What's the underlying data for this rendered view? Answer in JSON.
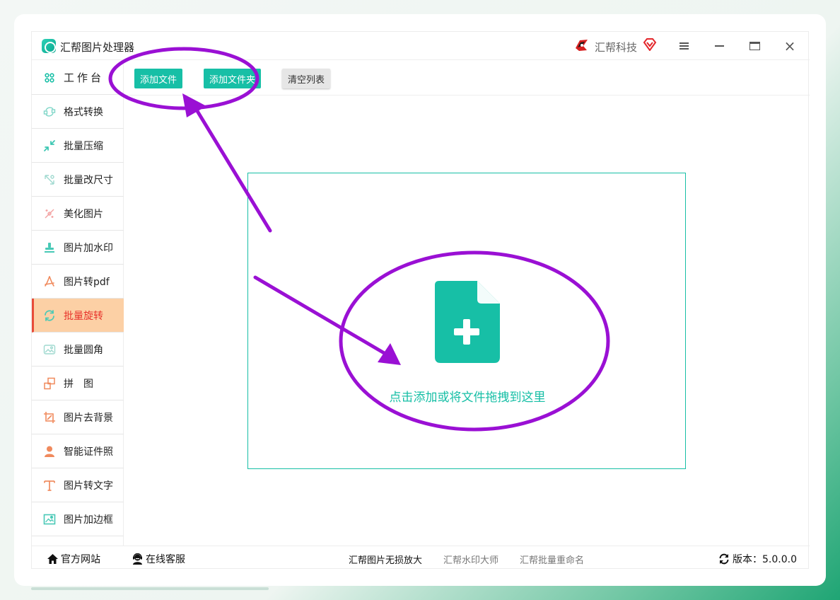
{
  "window": {
    "app_title": "汇帮图片处理器",
    "brand_name": "汇帮科技",
    "icons": {
      "logo": "app-logo-icon",
      "brand": "huibang-logo-icon",
      "vip": "diamond-vip-icon",
      "menu": "menu-icon",
      "minimize": "minimize-icon",
      "maximize": "maximize-icon",
      "close": "close-icon"
    },
    "close_glyph": "×"
  },
  "sidebar": {
    "items": [
      {
        "label": "工作台",
        "icon": "grid-icon",
        "active": false
      },
      {
        "label": "格式转换",
        "icon": "convert-icon",
        "active": false
      },
      {
        "label": "批量压缩",
        "icon": "compress-icon",
        "active": false
      },
      {
        "label": "批量改尺寸",
        "icon": "resize-icon",
        "active": false
      },
      {
        "label": "美化图片",
        "icon": "beautify-icon",
        "active": false
      },
      {
        "label": "图片加水印",
        "icon": "stamp-icon",
        "active": false
      },
      {
        "label": "图片转pdf",
        "icon": "pdf-icon",
        "active": false
      },
      {
        "label": "批量旋转",
        "icon": "rotate-icon",
        "active": true
      },
      {
        "label": "批量圆角",
        "icon": "rounded-corner-icon",
        "active": false
      },
      {
        "label": "拼　图",
        "icon": "puzzle-icon",
        "active": false
      },
      {
        "label": "图片去背景",
        "icon": "crop-icon",
        "active": false
      },
      {
        "label": "智能证件照",
        "icon": "person-icon",
        "active": false
      },
      {
        "label": "图片转文字",
        "icon": "text-icon",
        "active": false
      },
      {
        "label": "图片加边框",
        "icon": "frame-icon",
        "active": false
      }
    ]
  },
  "toolbar": {
    "add_file": "添加文件",
    "add_folder": "添加文件夹",
    "clear_list": "清空列表"
  },
  "dropzone": {
    "hint": "点击添加或将文件拖拽到这里",
    "icon": "file-add-icon"
  },
  "footer": {
    "website": "官方网站",
    "support": "在线客服",
    "lossless": "汇帮图片无损放大",
    "watermark": "汇帮水印大师",
    "rename": "汇帮批量重命名",
    "version": "版本：5.0.0.0"
  },
  "colors": {
    "accent": "#17bfa6",
    "active_bg": "#fcd0a5",
    "active_text": "#e8322a",
    "annotation": "#9a10d4"
  }
}
